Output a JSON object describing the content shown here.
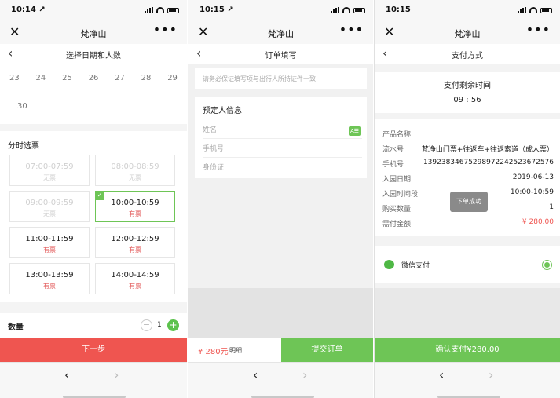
{
  "status": {
    "time1": "10:14 ↗",
    "time2": "10:15 ↗",
    "time3": "10:15"
  },
  "app": {
    "title": "梵净山",
    "close_icon": "close-icon",
    "more_icon": "more-icon"
  },
  "screen1": {
    "subtitle": "选择日期和人数",
    "days": [
      "23",
      "24",
      "25",
      "26",
      "27",
      "28",
      "29"
    ],
    "day30": "30",
    "slots_header": "分时选票",
    "slots": [
      {
        "time": "07:00-07:59",
        "status": "无票",
        "disabled": true,
        "selected": false
      },
      {
        "time": "08:00-08:59",
        "status": "无票",
        "disabled": true,
        "selected": false
      },
      {
        "time": "09:00-09:59",
        "status": "无票",
        "disabled": true,
        "selected": false
      },
      {
        "time": "10:00-10:59",
        "status": "有票",
        "disabled": false,
        "selected": true
      },
      {
        "time": "11:00-11:59",
        "status": "有票",
        "disabled": false,
        "selected": false
      },
      {
        "time": "12:00-12:59",
        "status": "有票",
        "disabled": false,
        "selected": false
      },
      {
        "time": "13:00-13:59",
        "status": "有票",
        "disabled": false,
        "selected": false
      },
      {
        "time": "14:00-14:59",
        "status": "有票",
        "disabled": false,
        "selected": false
      }
    ],
    "check_mark": "✓",
    "qty_label": "数量",
    "qty_minus": "−",
    "qty_value": "1",
    "qty_plus": "+",
    "next_button": "下一步"
  },
  "screen2": {
    "subtitle": "订单填写",
    "notice": "请务必保证填写项与出行人所持证件一致",
    "booker_header": "预定人信息",
    "name_placeholder": "姓名",
    "phone_placeholder": "手机号",
    "id_placeholder": "身份证",
    "contact_icon_text": "A☰",
    "price": "¥ 280元",
    "detail": "明细",
    "submit_button": "提交订单"
  },
  "screen3": {
    "subtitle": "支付方式",
    "timer_label": "支付剩余时间",
    "timer_value": "09 : 56",
    "rows": [
      {
        "k": "产品名称",
        "v": ""
      },
      {
        "k": "流水号",
        "v": "梵净山门票+往返车+往返索道（成人票）"
      },
      {
        "k": "手机号",
        "v": "13923834675298972242523672576"
      },
      {
        "k": "入园日期",
        "v": "2019-06-13"
      },
      {
        "k": "入园时间段",
        "v": "10:00-10:59"
      },
      {
        "k": "购买数量",
        "v": "1"
      },
      {
        "k": "需付金额",
        "v": "¥ 280.00"
      }
    ],
    "toast": "下单成功",
    "wechat_pay": "微信支付",
    "confirm_button": "确认支付¥280.00"
  },
  "nav": {
    "back": "‹",
    "forward": "›",
    "back_icon": "chevron-left-icon",
    "forward_icon": "chevron-right-icon"
  },
  "colors": {
    "accent_green": "#6ec556",
    "accent_red": "#ef5550"
  }
}
